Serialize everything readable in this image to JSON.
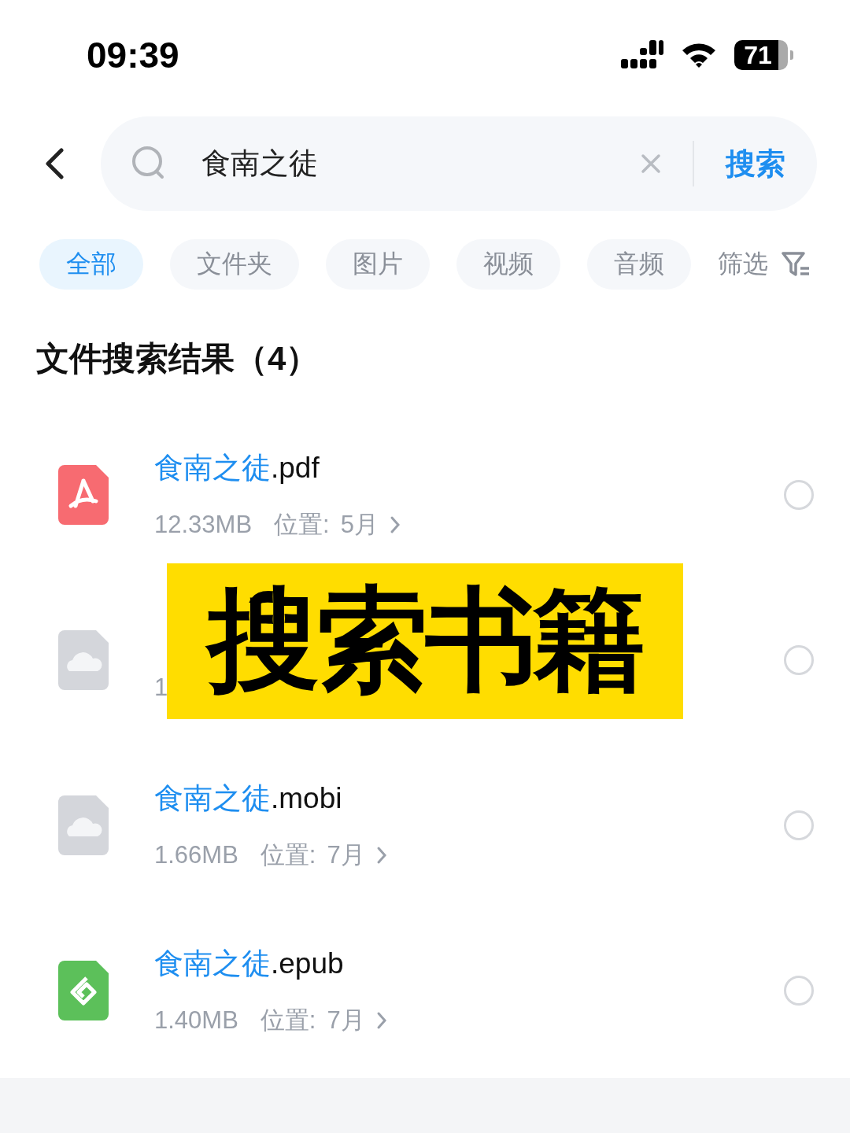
{
  "status_bar": {
    "time": "09:39",
    "battery": "71"
  },
  "search": {
    "value": "食南之徒",
    "button": "搜索"
  },
  "filters": [
    {
      "label": "全部",
      "selected": true
    },
    {
      "label": "文件夹",
      "selected": false
    },
    {
      "label": "图片",
      "selected": false
    },
    {
      "label": "视频",
      "selected": false
    },
    {
      "label": "音频",
      "selected": false
    }
  ],
  "filter_button": "筛选",
  "results_title": "文件搜索结果（4）",
  "files": [
    {
      "kind": "pdf",
      "name_match": "食南之徒",
      "name_rest": ".pdf",
      "size": "12.33MB",
      "location_label": "位置:",
      "location": "5月",
      "selected": false
    },
    {
      "kind": "cloud",
      "size": "1",
      "selected": false
    },
    {
      "kind": "cloud",
      "name_match": "食南之徒",
      "name_rest": ".mobi",
      "size": "1.66MB",
      "location_label": "位置:",
      "location": "7月",
      "selected": false
    },
    {
      "kind": "epub",
      "name_match": "食南之徒",
      "name_rest": ".epub",
      "size": "1.40MB",
      "location_label": "位置:",
      "location": "7月",
      "selected": false
    }
  ],
  "banner": "搜索书籍"
}
